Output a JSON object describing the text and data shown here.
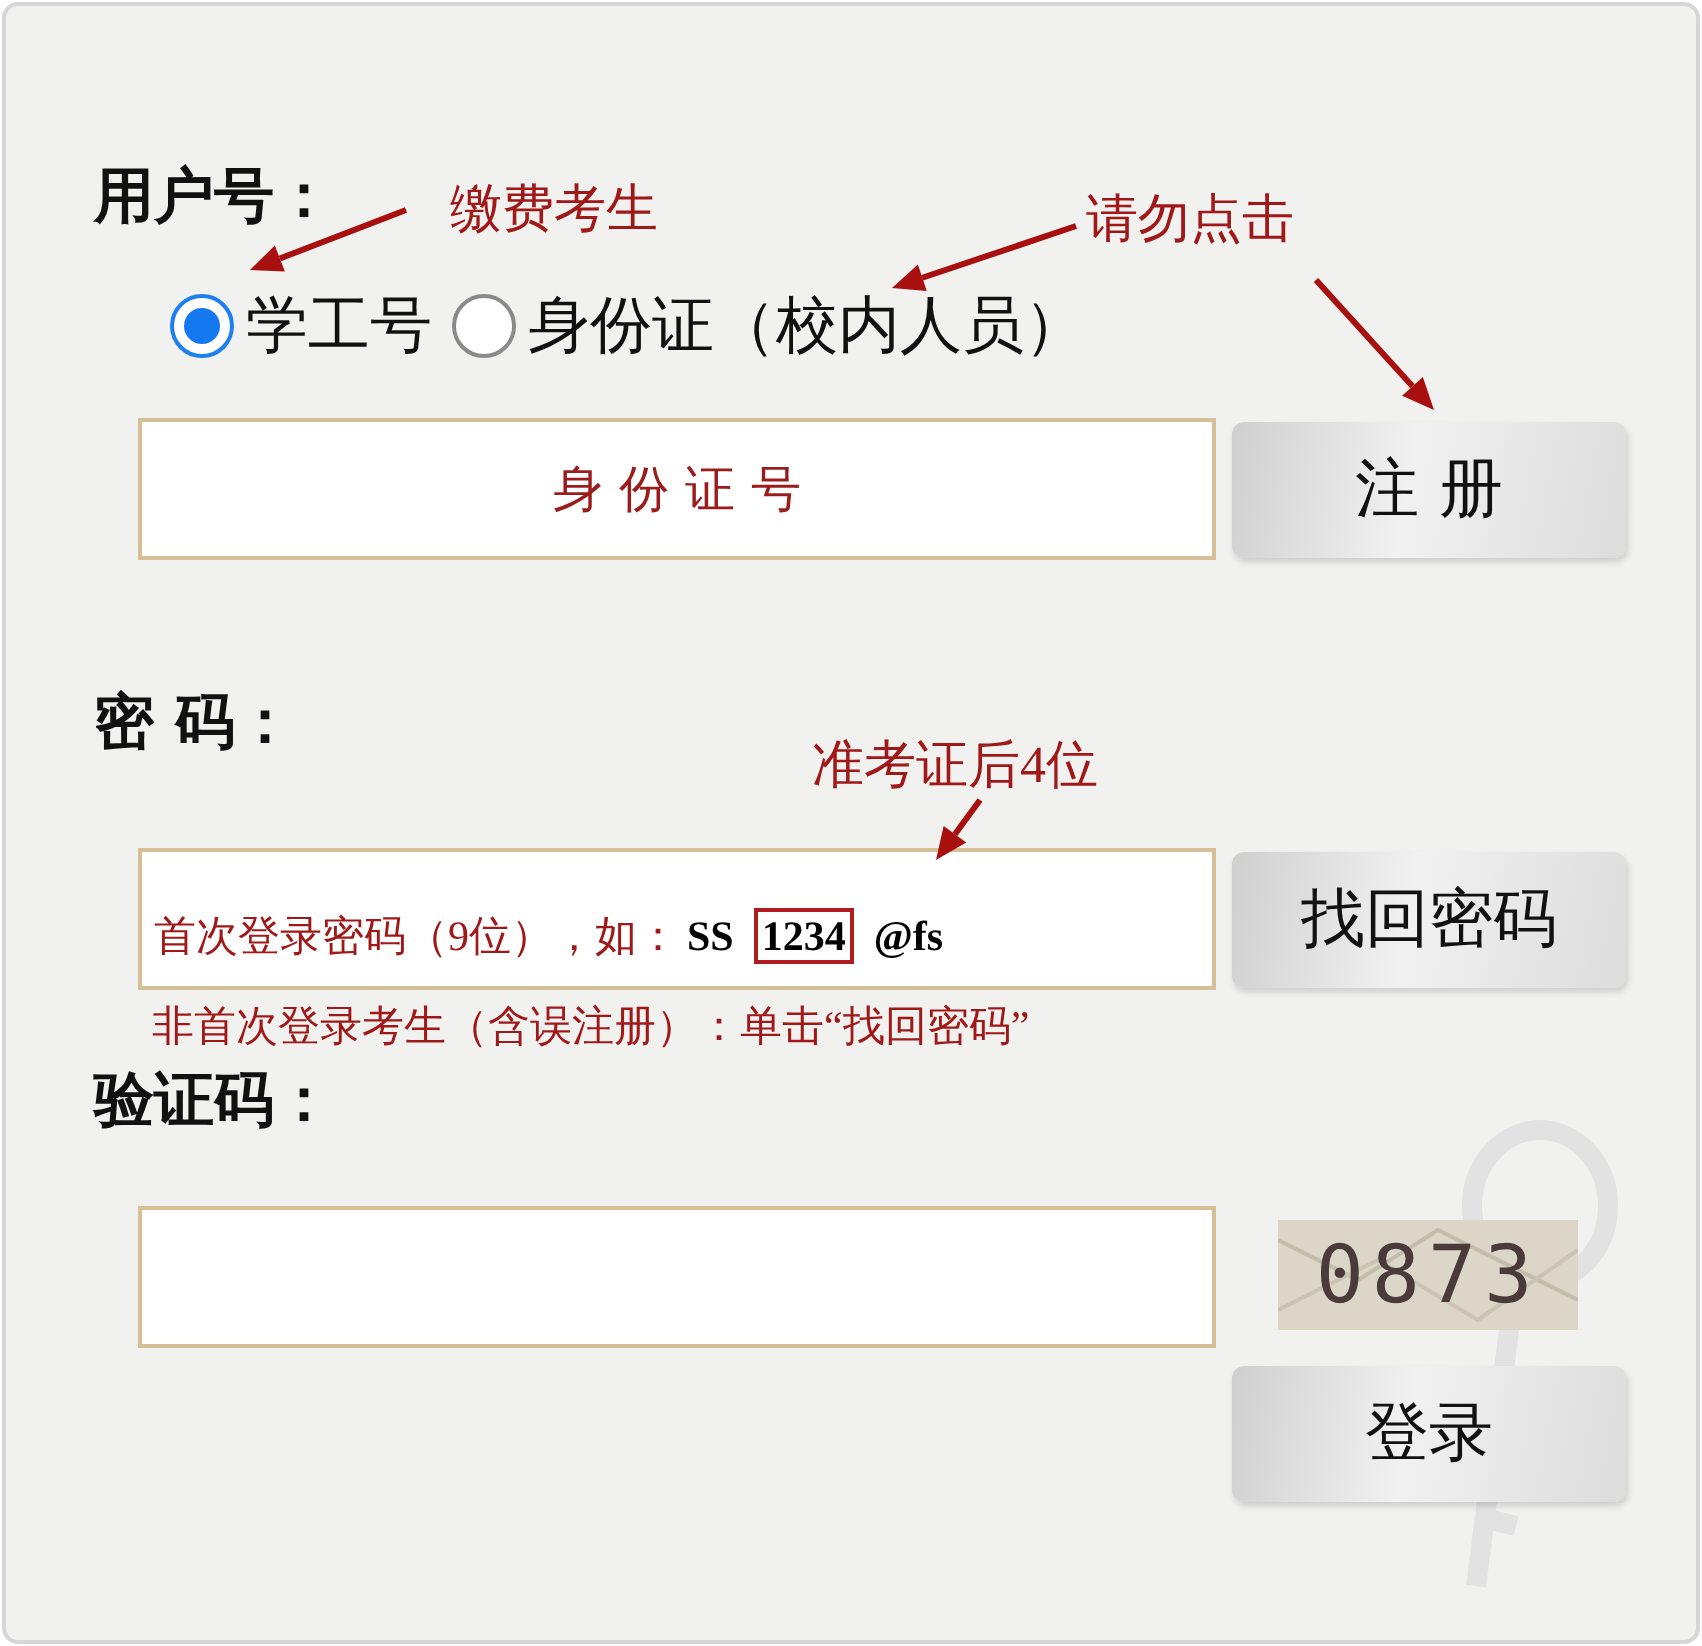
{
  "user_id": {
    "label": "用户号：",
    "options": [
      {
        "label": "学工号",
        "selected": true
      },
      {
        "label": "身份证（校内人员）",
        "selected": false
      }
    ],
    "field": {
      "placeholder": "身 份 证 号"
    },
    "register_button": "注 册"
  },
  "password": {
    "label": "密 码：",
    "hint": {
      "text": "首次登录密码（9位），如：",
      "example": [
        {
          "text": "SS",
          "highlighted": false
        },
        {
          "text": "1234",
          "highlighted": true
        },
        {
          "text": "@fs",
          "highlighted": false
        }
      ]
    },
    "recover_button": "找回密码",
    "note": "非首次登录考生（含误注册）：单击“找回密码”"
  },
  "captcha": {
    "label": "验证码：",
    "code": "0873",
    "login_button": "登录"
  },
  "annotations": [
    {
      "text": "缴费考生"
    },
    {
      "text": "请勿点击"
    },
    {
      "text": "准考证后4位"
    }
  ]
}
